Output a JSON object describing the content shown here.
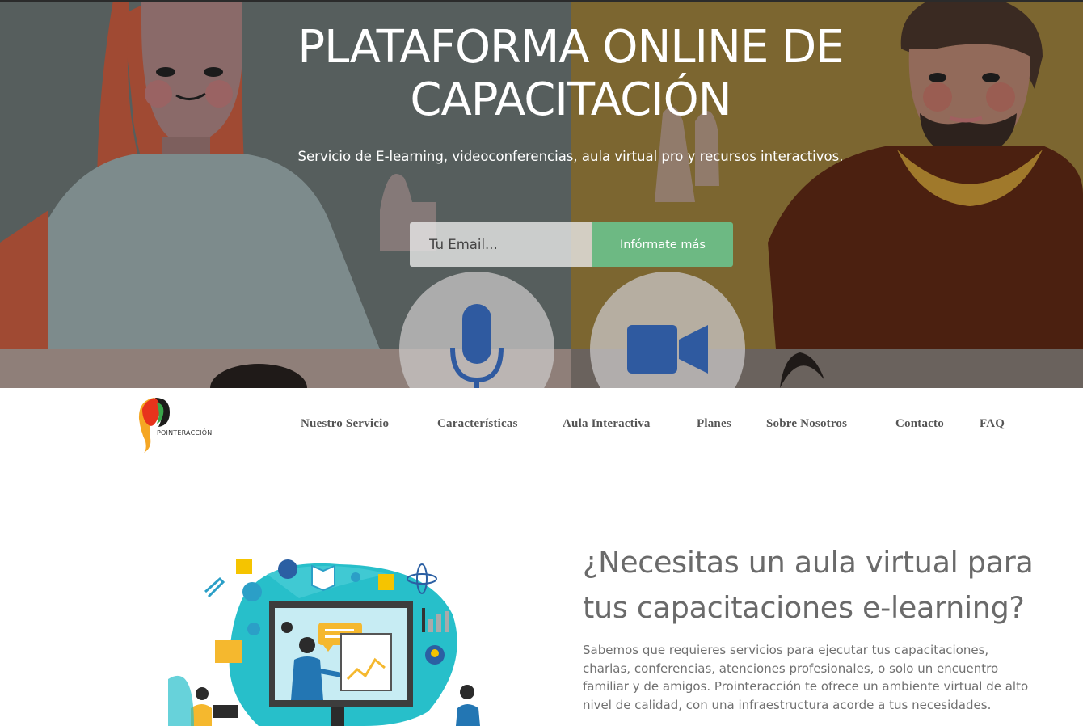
{
  "hero": {
    "title_line1": "PLATAFORMA ONLINE DE",
    "title_line2": "CAPACITACIÓN",
    "subtitle": "Servicio de E-learning, videoconferencias, aula virtual pro y recursos interactivos.",
    "email_placeholder": "Tu Email...",
    "submit_label": "Infórmate más",
    "icons": [
      "microphone-icon",
      "video-camera-icon"
    ]
  },
  "navbar": {
    "logo_text": "POINTERACCIÓN",
    "items": [
      {
        "label": "Nuestro Servicio"
      },
      {
        "label": "Características"
      },
      {
        "label": "Aula Interactiva"
      },
      {
        "label": "Planes"
      },
      {
        "label": "Sobre Nosotros"
      },
      {
        "label": "Contacto"
      },
      {
        "label": "FAQ"
      }
    ]
  },
  "section": {
    "heading_line1": "¿Necesitas un aula virtual para",
    "heading_line2": "tus capacitaciones e-learning?",
    "body_lines": [
      "Sabemos que requieres servicios para ejecutar tus capacitaciones,",
      "charlas, conferencias, atenciones profesionales, o solo un encuentro",
      "familiar y de amigos. Prointeracción te ofrece un ambiente virtual de alto",
      "nivel de calidad, con una infraestructura acorde a tus necesidades."
    ]
  },
  "colors": {
    "accent_green": "#6db983",
    "nav_text": "#555555",
    "heading_text": "#6a6a6a",
    "body_text": "#707070"
  }
}
